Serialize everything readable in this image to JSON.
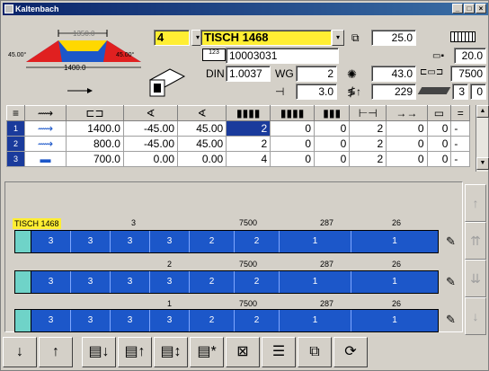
{
  "window": {
    "title": "Kaltenbach"
  },
  "profile": {
    "top_dim": "1350.0",
    "bottom_dim": "1400.0",
    "left_angle": "45.00°",
    "right_angle": "45.00°"
  },
  "header": {
    "qty": "4",
    "name": "TISCH 1468",
    "article_no": "10003031",
    "din_label": "DIN",
    "din_value": "1.0037",
    "wg_label": "WG",
    "wg_value": "2",
    "field_a": "3.0",
    "field_top_right": "25.0",
    "field_b": "43.0",
    "field_c": "229",
    "right_1": "20.0",
    "right_2": "7500",
    "right_3": "3",
    "right_4": "0"
  },
  "table": {
    "headers": [
      "≡",
      "⟿",
      "⊏⊐",
      "∢",
      "∢",
      "▮▮▮▮",
      "▮▮▮▮",
      "▮▮▮",
      "⊢⊣",
      "→→",
      "▭",
      "="
    ],
    "rows": [
      {
        "idx": "1",
        "c1": "1400.0",
        "c2": "-45.00",
        "c3": "45.00",
        "c4": "2",
        "c5": "0",
        "c6": "0",
        "c7": "2",
        "c8": "0",
        "c9": "0",
        "c10": "-"
      },
      {
        "idx": "2",
        "c1": "800.0",
        "c2": "-45.00",
        "c3": "45.00",
        "c4": "2",
        "c5": "0",
        "c6": "0",
        "c7": "2",
        "c8": "0",
        "c9": "0",
        "c10": "-"
      },
      {
        "idx": "3",
        "c1": "700.0",
        "c2": "0.00",
        "c3": "0.00",
        "c4": "4",
        "c5": "0",
        "c6": "0",
        "c7": "2",
        "c8": "0",
        "c9": "0",
        "c10": "-"
      }
    ]
  },
  "bars": [
    {
      "tag": "TISCH 1468",
      "count": "3",
      "length": "7500",
      "rest": "287",
      "pieces": "26",
      "cells": [
        "3",
        "3",
        "3",
        "3",
        "2",
        "2",
        "1",
        "1"
      ]
    },
    {
      "count": "2",
      "length": "7500",
      "rest": "287",
      "pieces": "26",
      "cells": [
        "3",
        "3",
        "3",
        "3",
        "2",
        "2",
        "1",
        "1"
      ]
    },
    {
      "count": "1",
      "length": "7500",
      "rest": "287",
      "pieces": "26",
      "cells": [
        "3",
        "3",
        "3",
        "3",
        "2",
        "2",
        "1",
        "1"
      ]
    }
  ],
  "colors": {
    "bar": "#1c57c9",
    "accent_yellow": "#ffee33",
    "selection": "#1a3b9c"
  },
  "toolbar": [
    "arrow-down-icon",
    "arrow-up-icon",
    "doc-down-icon",
    "doc-up-icon",
    "doc-sort-icon",
    "doc-new-icon",
    "doc-delete-icon",
    "split-icon",
    "copy-icon",
    "cycle-icon"
  ]
}
